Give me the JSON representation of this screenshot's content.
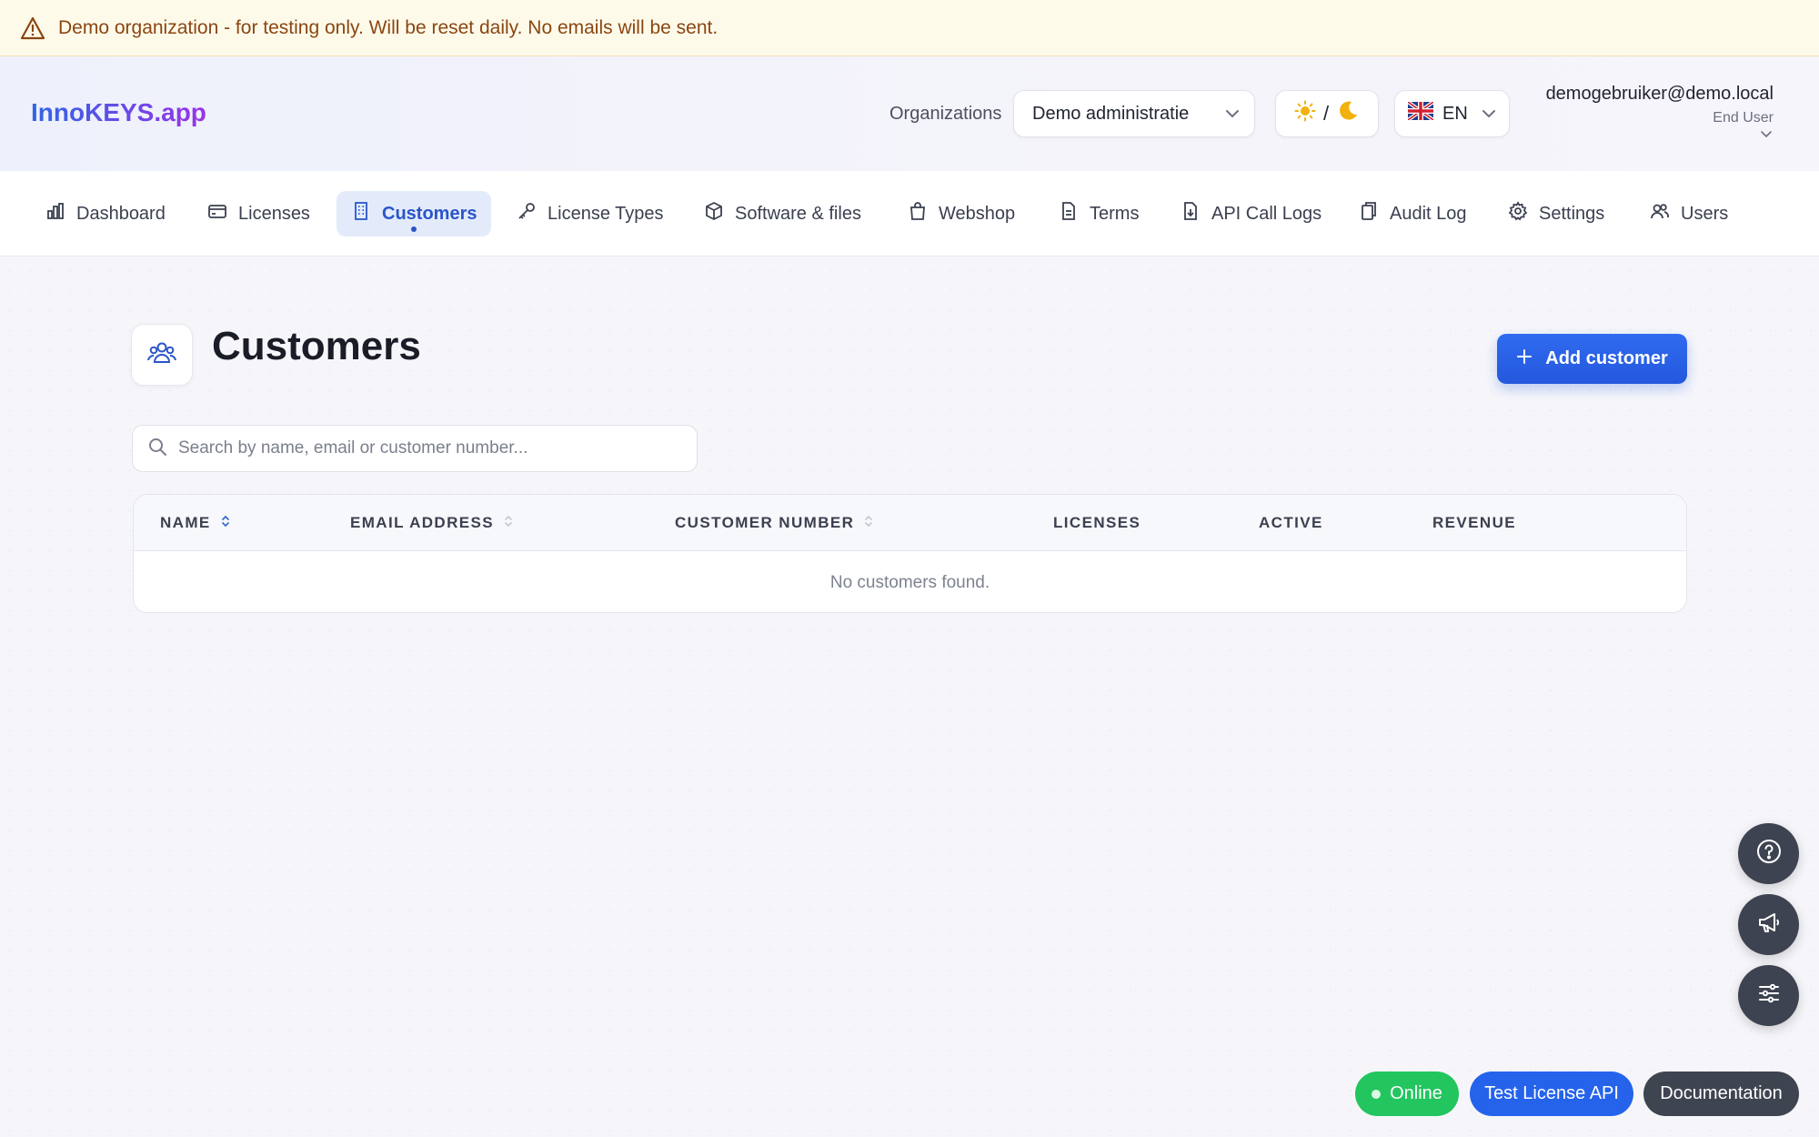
{
  "banner": {
    "text": "Demo organization - for testing only. Will be reset daily. No emails will be sent."
  },
  "header": {
    "logo": "InnoKEYS.app",
    "org_label": "Organizations",
    "org_value": "Demo administratie",
    "theme_separator": "/",
    "lang_value": "EN",
    "user_email": "demogebruiker@demo.local",
    "user_role": "End User"
  },
  "nav": {
    "items": [
      {
        "label": "Dashboard",
        "icon": "bar-chart-icon"
      },
      {
        "label": "Licenses",
        "icon": "credit-card-icon"
      },
      {
        "label": "Customers",
        "icon": "building-icon",
        "active": true
      },
      {
        "label": "License Types",
        "icon": "key-icon"
      },
      {
        "label": "Software & files",
        "icon": "package-icon"
      },
      {
        "label": "Webshop",
        "icon": "shopping-bag-icon"
      },
      {
        "label": "Terms",
        "icon": "document-icon"
      },
      {
        "label": "API Call Logs",
        "icon": "file-download-icon"
      },
      {
        "label": "Audit Log",
        "icon": "clipboard-icon"
      },
      {
        "label": "Settings",
        "icon": "gear-icon"
      },
      {
        "label": "Users",
        "icon": "users-icon"
      }
    ]
  },
  "main": {
    "title": "Customers",
    "add_button": "Add customer",
    "search_placeholder": "Search by name, email or customer number...",
    "search_value": "",
    "table": {
      "columns": [
        "NAME",
        "EMAIL ADDRESS",
        "CUSTOMER NUMBER",
        "LICENSES",
        "ACTIVE",
        "REVENUE"
      ],
      "empty_text": "No customers found."
    }
  },
  "footer": {
    "status": "Online",
    "test_api": "Test License API",
    "docs": "Documentation"
  },
  "colors": {
    "accent": "#2563eb",
    "online": "#22c55e",
    "banner_bg": "#fefaea",
    "banner_text": "#8a4611"
  }
}
